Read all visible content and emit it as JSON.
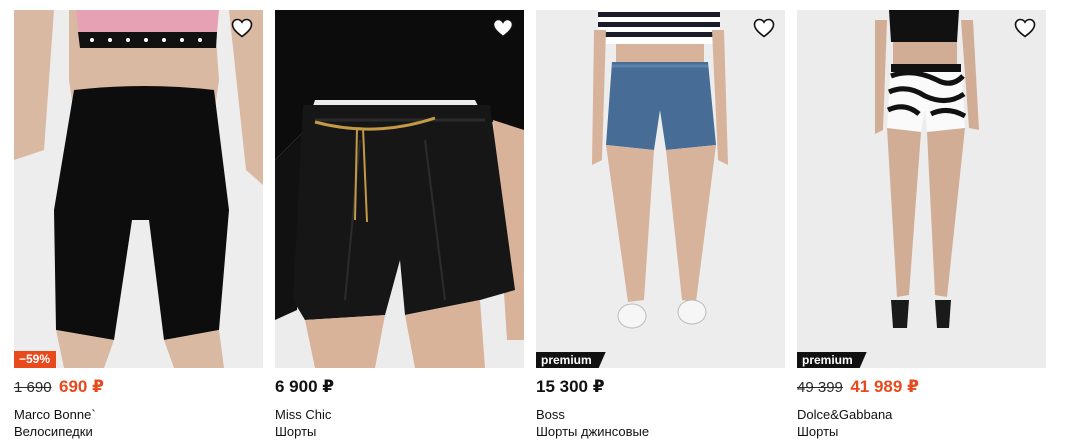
{
  "products": [
    {
      "brand": "Marco Bonne`",
      "title": "Велосипедки",
      "old_price": "1 690",
      "price": "690 ₽",
      "badge": "−59%",
      "favorite_icon": "heart-outline-icon"
    },
    {
      "brand": "Miss Chic",
      "title": "Шорты",
      "price": "6 900 ₽",
      "favorite_icon": "heart-outline-icon"
    },
    {
      "brand": "Boss",
      "title": "Шорты джинсовые",
      "price": "15 300 ₽",
      "badge": "premium",
      "favorite_icon": "heart-outline-icon"
    },
    {
      "brand": "Dolce&Gabbana",
      "title": "Шорты",
      "old_price": "49 399",
      "price": "41 989 ₽",
      "badge": "premium",
      "favorite_icon": "heart-outline-icon"
    }
  ],
  "colors": {
    "sale": "#e84a1c",
    "premium_badge": "#111111",
    "photo_background": "#f1f1f1"
  }
}
